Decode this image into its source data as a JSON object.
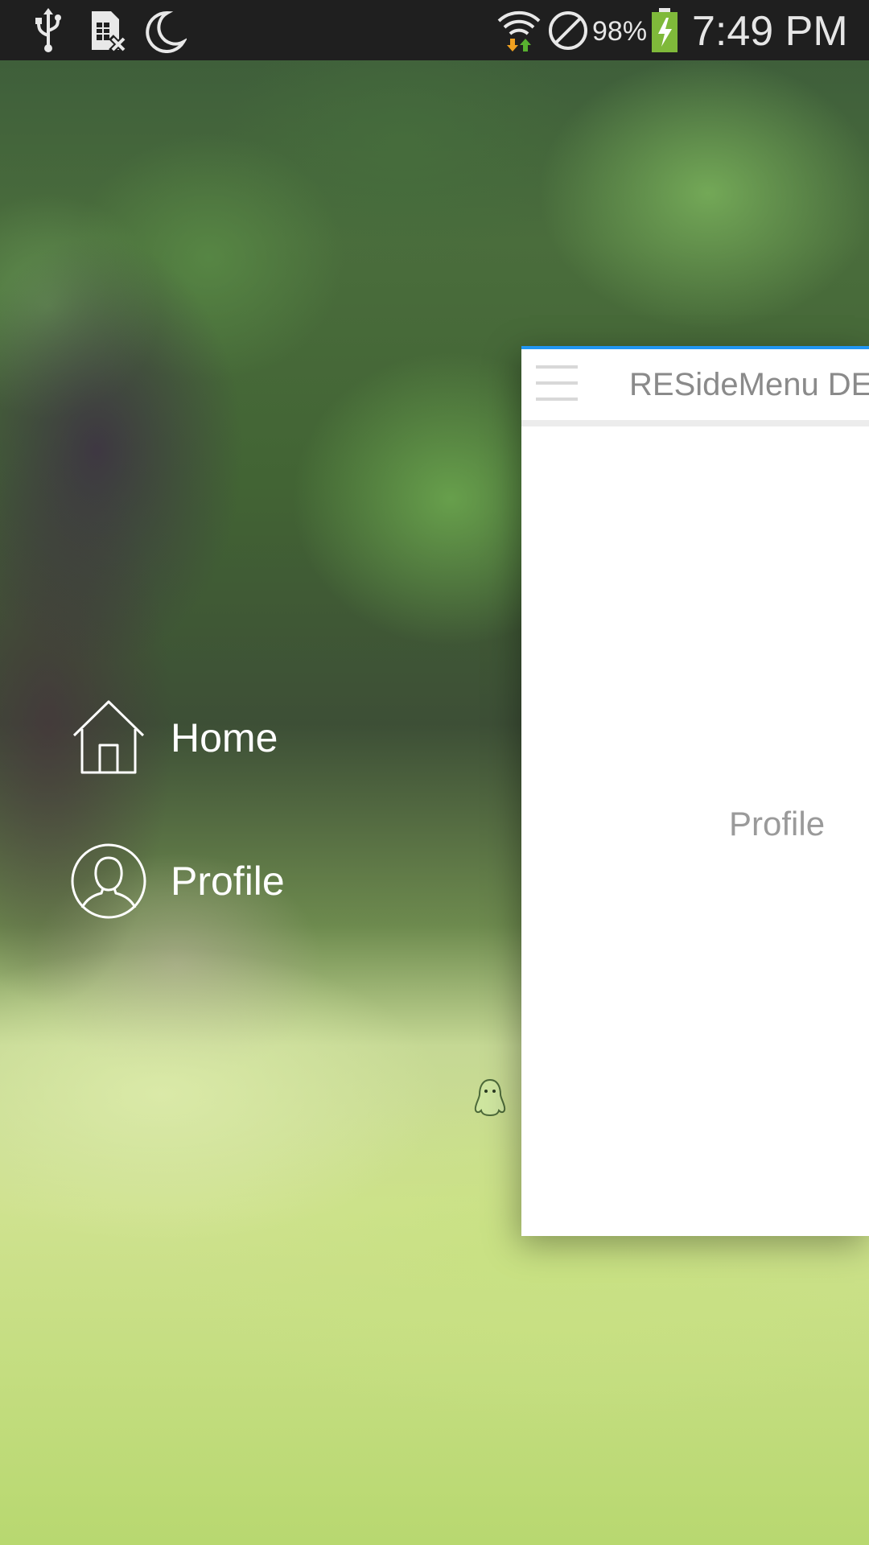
{
  "status_bar": {
    "left_icons": [
      "usb-icon",
      "sim-card-missing-icon",
      "do-not-disturb-moon-icon"
    ],
    "right_icons": [
      "wifi-icon",
      "blocked-circle-icon",
      "battery-charging-icon"
    ],
    "battery": "98%",
    "time": "7:49 PM"
  },
  "menu": {
    "items": [
      {
        "label": "Home",
        "icon": "home-icon"
      },
      {
        "label": "Profile",
        "icon": "user-profile-icon"
      }
    ]
  },
  "content": {
    "title": "RESideMenu DE",
    "body_text": "Profile",
    "menu_button_icon": "hamburger-menu-icon"
  },
  "colors": {
    "accent_line": "#2196f3",
    "menu_text": "#ffffff",
    "title_text": "#8a8a8a"
  }
}
